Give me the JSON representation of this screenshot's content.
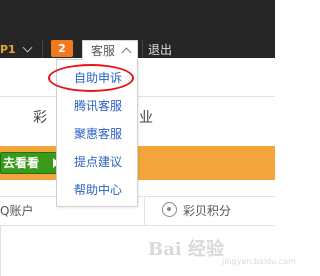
{
  "topbar": {
    "user_code": "P1",
    "notification_count": "2",
    "service_tab": "客服",
    "logout": "退出"
  },
  "dropdown": {
    "items": [
      "自助申诉",
      "腾讯客服",
      "聚惠客服",
      "提点建议",
      "帮助中心"
    ],
    "highlighted_index": 0
  },
  "content": {
    "tab_left": "彩",
    "tab_right": "业",
    "go_button": "去看看",
    "qq_account": "Q账户",
    "shell_points": "彩贝积分"
  },
  "watermark": {
    "text": "Bai 经验",
    "sub": "jingyan.baidu.com"
  },
  "colors": {
    "topbar_bg": "#262626",
    "badge": "#f07a1d",
    "link_blue": "#2a63c4",
    "highlight_red": "#e3141b",
    "banner_orange": "#f3a43a",
    "button_green": "#3a9a1a"
  }
}
